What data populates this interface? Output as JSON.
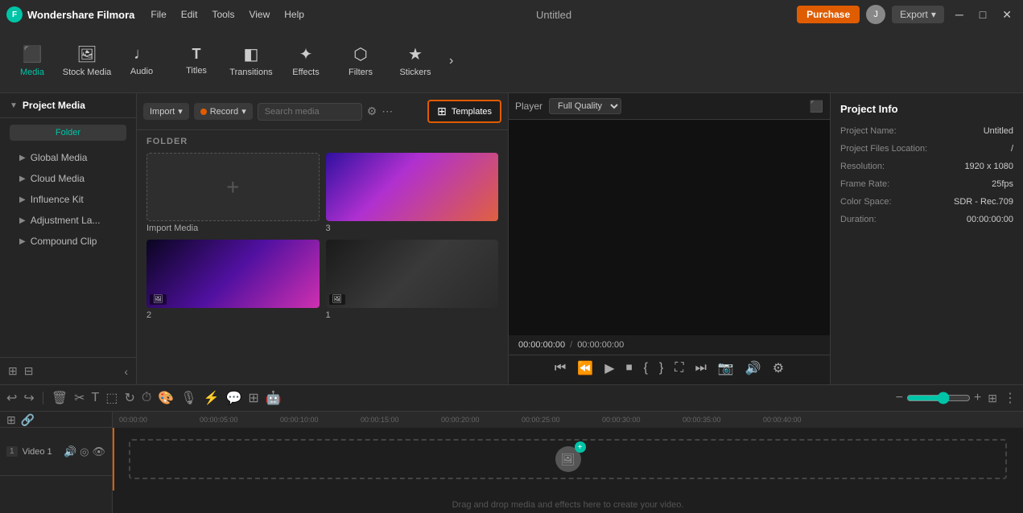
{
  "titlebar": {
    "app_name": "Wondershare Filmora",
    "menu": [
      "File",
      "Edit",
      "Tools",
      "View",
      "Help"
    ],
    "title": "Untitled",
    "purchase_label": "Purchase",
    "export_label": "Export",
    "user_initial": "J"
  },
  "toolbar": {
    "items": [
      {
        "id": "media",
        "label": "Media",
        "icon": "🎬"
      },
      {
        "id": "stock-media",
        "label": "Stock Media",
        "icon": "🗂️"
      },
      {
        "id": "audio",
        "label": "Audio",
        "icon": "🎵"
      },
      {
        "id": "titles",
        "label": "Titles",
        "icon": "T"
      },
      {
        "id": "transitions",
        "label": "Transitions",
        "icon": "⟷"
      },
      {
        "id": "effects",
        "label": "Effects",
        "icon": "✨"
      },
      {
        "id": "filters",
        "label": "Filters",
        "icon": "🔧"
      },
      {
        "id": "stickers",
        "label": "Stickers",
        "icon": "⭐"
      }
    ]
  },
  "left_panel": {
    "title": "Project Media",
    "items": [
      {
        "id": "global-media",
        "label": "Global Media"
      },
      {
        "id": "cloud-media",
        "label": "Cloud Media"
      },
      {
        "id": "influence-kit",
        "label": "Influence Kit"
      },
      {
        "id": "adjustment-la",
        "label": "Adjustment La..."
      },
      {
        "id": "compound-clip",
        "label": "Compound Clip"
      }
    ],
    "folder_label": "Folder"
  },
  "media_panel": {
    "import_label": "Import",
    "record_label": "Record",
    "search_placeholder": "Search media",
    "templates_label": "Templates",
    "folder_section": "FOLDER",
    "items": [
      {
        "id": "import-media",
        "label": "Import Media",
        "type": "add"
      },
      {
        "id": "item-3",
        "label": "3",
        "type": "thumb-purple"
      },
      {
        "id": "item-2",
        "label": "2",
        "type": "thumb-neon"
      },
      {
        "id": "item-1",
        "label": "1",
        "type": "thumb-hand"
      }
    ]
  },
  "preview": {
    "label": "Player",
    "quality": "Full Quality",
    "timecode_current": "00:00:00:00",
    "timecode_sep": "/",
    "timecode_total": "00:00:00:00",
    "controls": [
      "⏮",
      "⏪",
      "▶",
      "⏹",
      "{",
      "}",
      "⛶",
      "⏭",
      "📷",
      "🔊",
      "⚙"
    ]
  },
  "right_panel": {
    "title": "Project Info",
    "fields": [
      {
        "label": "Project Name:",
        "value": "Untitled"
      },
      {
        "label": "Project Files Location:",
        "value": "/"
      },
      {
        "label": "Resolution:",
        "value": "1920 x 1080"
      },
      {
        "label": "Frame Rate:",
        "value": "25fps"
      },
      {
        "label": "Color Space:",
        "value": "SDR - Rec.709"
      },
      {
        "label": "Duration:",
        "value": "00:00:00:00"
      }
    ]
  },
  "timeline": {
    "time_marks": [
      "00:00:00",
      "00:00:05:00",
      "00:00:10:00",
      "00:00:15:00",
      "00:00:20:00",
      "00:00:25:00",
      "00:00:30:00",
      "00:00:35:00",
      "00:00:40:00"
    ],
    "track_label": "Video 1",
    "drop_text": "Drag and drop media and effects here to create your video."
  }
}
